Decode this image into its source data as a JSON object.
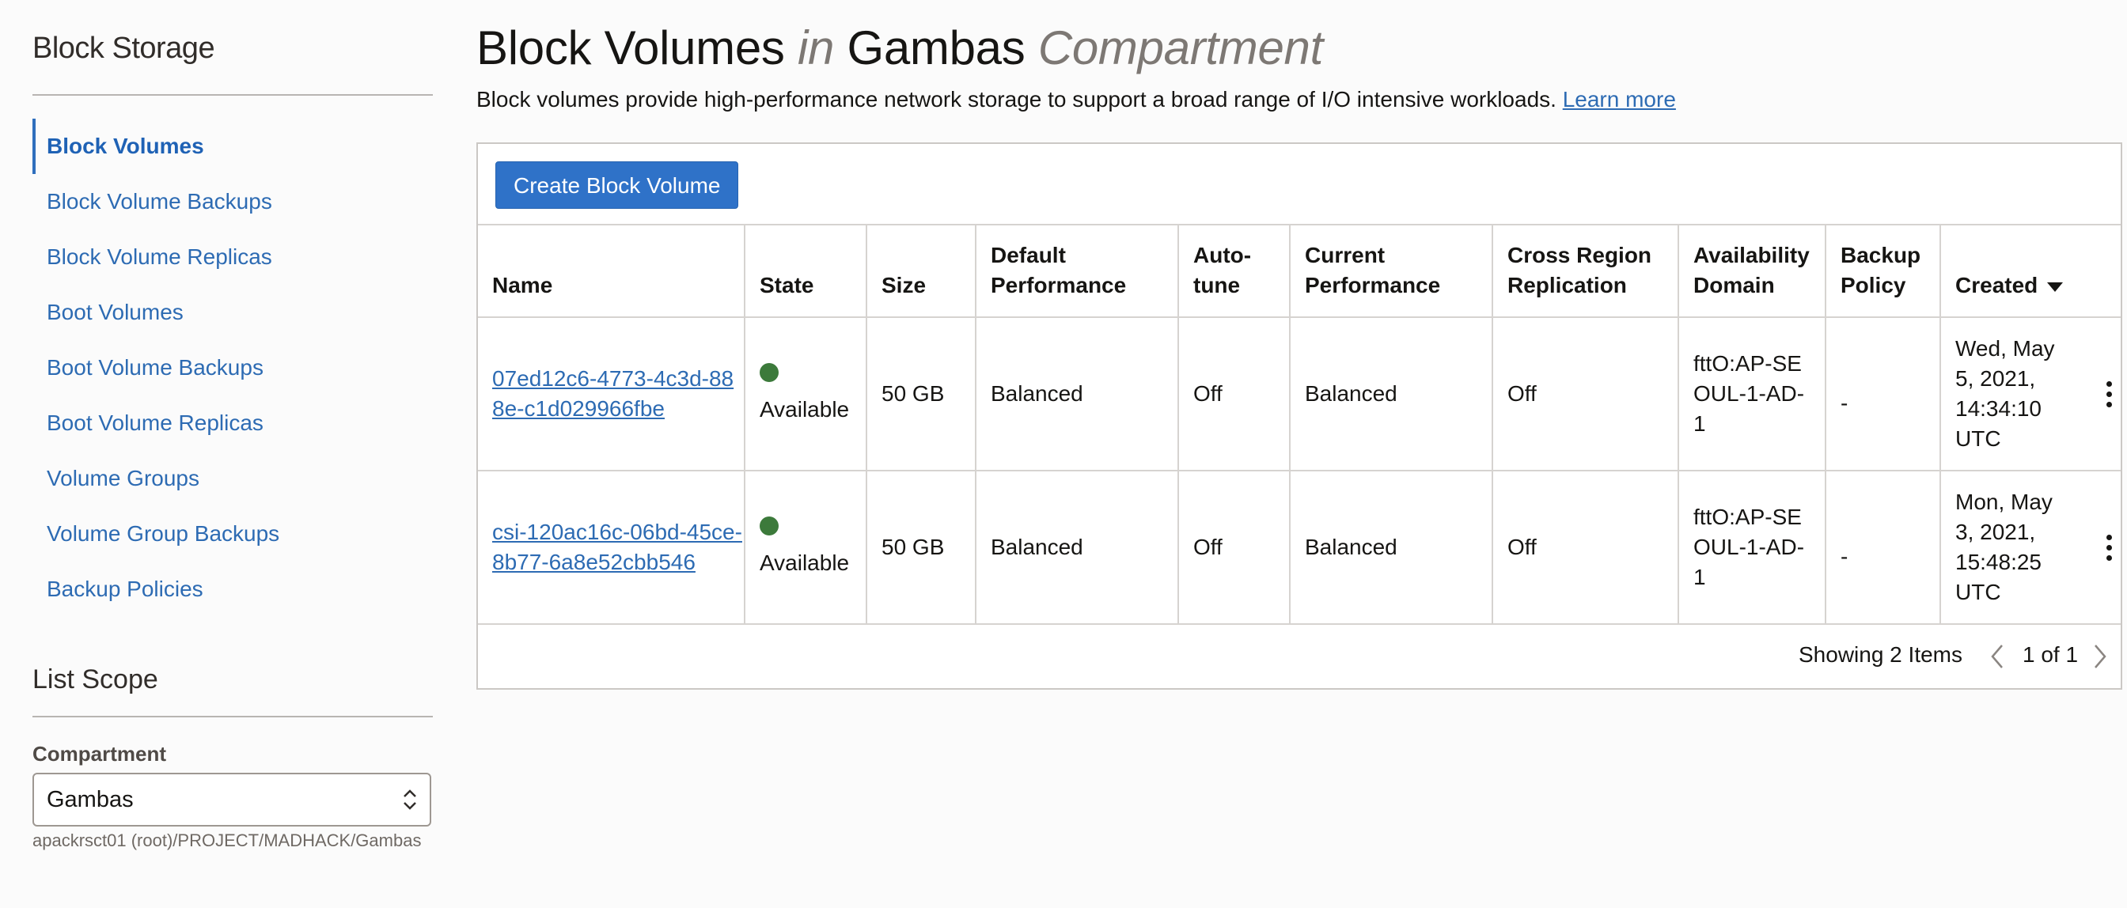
{
  "sidebar": {
    "title": "Block Storage",
    "items": [
      {
        "label": "Block Volumes",
        "active": true
      },
      {
        "label": "Block Volume Backups"
      },
      {
        "label": "Block Volume Replicas"
      },
      {
        "label": "Boot Volumes"
      },
      {
        "label": "Boot Volume Backups"
      },
      {
        "label": "Boot Volume Replicas"
      },
      {
        "label": "Volume Groups"
      },
      {
        "label": "Volume Group Backups"
      },
      {
        "label": "Backup Policies"
      }
    ],
    "list_scope": {
      "title": "List Scope",
      "compartment_label": "Compartment",
      "compartment_value": "Gambas",
      "compartment_path": "apackrsct01 (root)/PROJECT/MADHACK/Gambas"
    }
  },
  "header": {
    "title_part1": "Block Volumes",
    "title_in": "in",
    "title_compartment": "Gambas",
    "title_suffix": "Compartment",
    "description": "Block volumes provide high-performance network storage to support a broad range of I/O intensive workloads.",
    "learn_more": "Learn more"
  },
  "toolbar": {
    "create_label": "Create Block Volume"
  },
  "table": {
    "columns": [
      {
        "label": "Name"
      },
      {
        "label": "State"
      },
      {
        "label": "Size"
      },
      {
        "label": "Default Performance"
      },
      {
        "label": "Auto-tune"
      },
      {
        "label": "Current Performance"
      },
      {
        "label": "Cross Region Replication"
      },
      {
        "label": "Availability Domain"
      },
      {
        "label": "Backup Policy"
      },
      {
        "label": "Created"
      }
    ],
    "rows": [
      {
        "name": "07ed12c6-4773-4c3d-888e-c1d029966fbe",
        "state": "Available",
        "state_color": "#3c7a3b",
        "size": "50 GB",
        "default_performance": "Balanced",
        "auto_tune": "Off",
        "current_performance": "Balanced",
        "cross_region_replication": "Off",
        "availability_domain": "fttO:AP-SEOUL-1-AD-1",
        "backup_policy": "-",
        "created": "Wed, May 5, 2021, 14:34:10 UTC"
      },
      {
        "name": "csi-120ac16c-06bd-45ce-8b77-6a8e52cbb546",
        "state": "Available",
        "state_color": "#3c7a3b",
        "size": "50 GB",
        "default_performance": "Balanced",
        "auto_tune": "Off",
        "current_performance": "Balanced",
        "cross_region_replication": "Off",
        "availability_domain": "fttO:AP-SEOUL-1-AD-1",
        "backup_policy": "-",
        "created": "Mon, May 3, 2021, 15:48:25 UTC"
      }
    ],
    "footer": {
      "count_text": "Showing 2 Items",
      "page_text": "1 of 1"
    }
  },
  "colors": {
    "link": "#2d6bb3",
    "primary_button": "#2f72c8",
    "available": "#3c7a3b"
  }
}
